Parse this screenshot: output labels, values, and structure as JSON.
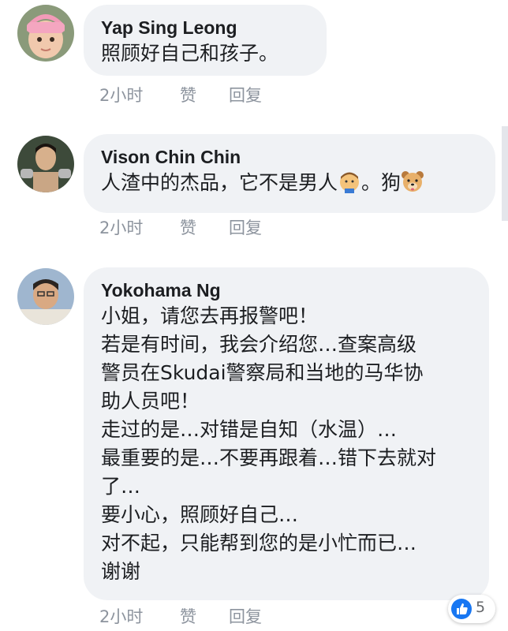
{
  "comments": [
    {
      "author": "Yap Sing Leong",
      "lines": [
        "照顾好自己和孩子。"
      ],
      "time": "2小时",
      "like": "赞",
      "reply": "回复"
    },
    {
      "author": "Vison Chin Chin",
      "text_before": "人渣中的杰品，它不是男人",
      "text_mid": "。狗",
      "emoji_1": "man-face-emoji",
      "emoji_2": "dog-face-emoji",
      "time": "2小时",
      "like": "赞",
      "reply": "回复"
    },
    {
      "author": "Yokohama Ng",
      "lines": [
        "小姐，请您去再报警吧！",
        "若是有时间，我会介绍您…查案高级",
        "警员在Skudai警察局和当地的马华协",
        "助人员吧！",
        "走过的是…对错是自知（水温）…",
        "最重要的是…不要再跟着…错下去就对",
        "了…",
        "要小心，照顾好自己…",
        "对不起，只能帮到您的是小忙而已…",
        "谢谢"
      ],
      "time": "2小时",
      "like": "赞",
      "reply": "回复"
    }
  ],
  "reactions": {
    "icon": "thumbs-up-icon",
    "count": "5",
    "color": "#1877f2"
  },
  "colors": {
    "bubble": "#f0f2f5",
    "meta": "#8d949e",
    "text": "#1c1e21"
  }
}
